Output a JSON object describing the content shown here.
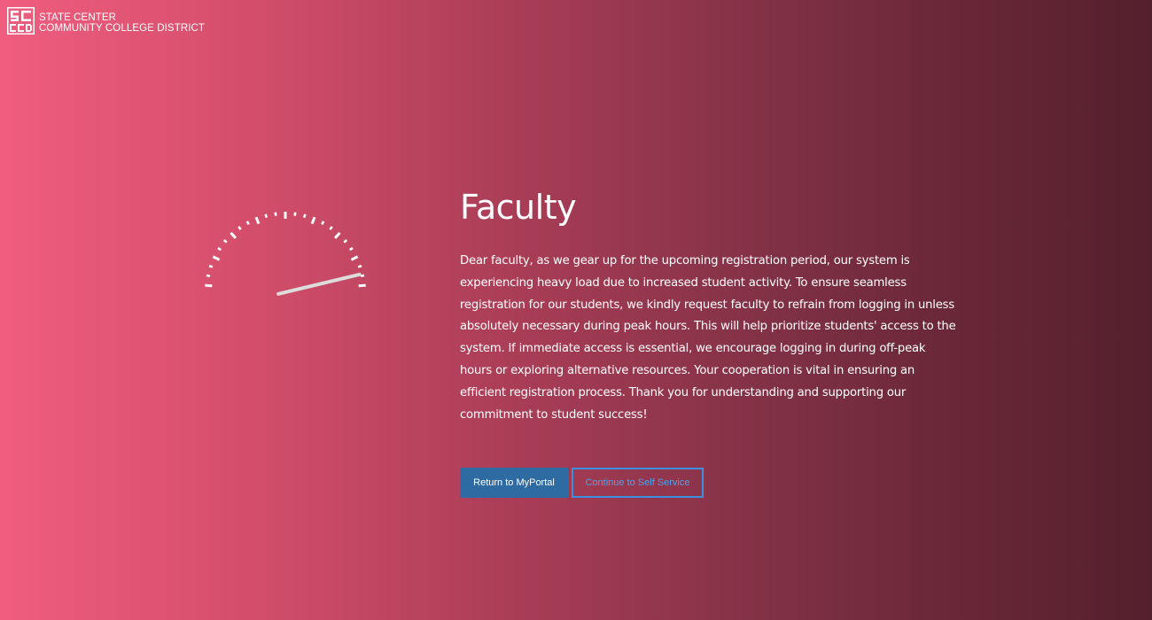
{
  "header": {
    "logo_letters": "SCCCD",
    "org_line1": "STATE CENTER",
    "org_line2": "COMMUNITY COLLEGE DISTRICT"
  },
  "gauge": {
    "icon": "speedometer-icon",
    "needle_level": 0.95
  },
  "main": {
    "title": "Faculty",
    "message": "Dear faculty, as we gear up for the upcoming registration period, our system is experiencing heavy load due to increased student activity. To ensure seamless registration for our students, we kindly request faculty to refrain from logging in unless absolutely necessary during peak hours. This will help prioritize students' access to the system. If immediate access is essential, we encourage logging in during off-peak hours or exploring alternative resources. Your cooperation is vital in ensuring an efficient registration process. Thank you for understanding and supporting our commitment to student success!"
  },
  "actions": {
    "primary_label": "Return to MyPortal",
    "secondary_label": "Continue to Self Service"
  },
  "colors": {
    "gradient_left": "#f05d7e",
    "gradient_right": "#55202d",
    "primary_button": "#2e6ba2",
    "secondary_button_border": "#3c90e0",
    "secondary_button_text": "#4aa3f0"
  }
}
